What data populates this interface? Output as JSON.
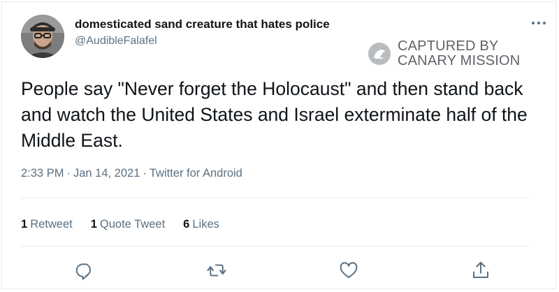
{
  "tweet": {
    "author": {
      "display_name": "domesticated sand creature that hates police",
      "handle": "@AudibleFalafel",
      "avatar_icon": "avatar-photo"
    },
    "text": "People say \"Never forget the Holocaust\" and then stand back and watch the United States and Israel exterminate half of the Middle East.",
    "time": "2:33 PM",
    "date": "Jan 14, 2021",
    "source": "Twitter for Android",
    "separator": "·",
    "stats": {
      "retweets": {
        "count": "1",
        "label": "Retweet"
      },
      "quote_tweets": {
        "count": "1",
        "label": "Quote Tweet"
      },
      "likes": {
        "count": "6",
        "label": "Likes"
      }
    },
    "actions": [
      {
        "name": "reply",
        "icon": "reply-icon"
      },
      {
        "name": "retweet",
        "icon": "retweet-icon"
      },
      {
        "name": "like",
        "icon": "heart-icon"
      },
      {
        "name": "share",
        "icon": "share-icon"
      }
    ],
    "more_icon": "more-icon"
  },
  "watermark": {
    "line1": "CAPTURED BY",
    "line2": "CANARY MISSION",
    "logo_icon": "canary-logo-icon"
  },
  "colors": {
    "text_primary": "#0f1419",
    "text_secondary": "#5b7083",
    "divider": "#e6ecf0",
    "watermark": "#5f6368"
  }
}
